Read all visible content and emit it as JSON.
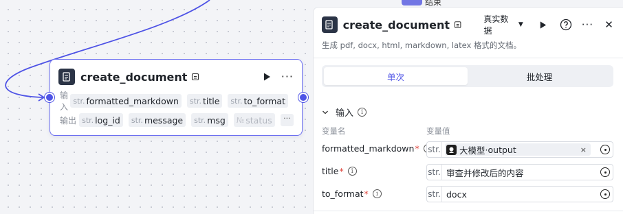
{
  "node": {
    "title": "create_document",
    "input_label": "输入",
    "output_label": "输出",
    "inputs": [
      {
        "type": "str.",
        "name": "formatted_markdown"
      },
      {
        "type": "str.",
        "name": "title"
      },
      {
        "type": "str.",
        "name": "to_format"
      }
    ],
    "outputs": [
      {
        "type": "str.",
        "name": "log_id"
      },
      {
        "type": "str.",
        "name": "message"
      },
      {
        "type": "str.",
        "name": "msg"
      },
      {
        "type": "№",
        "name": "status"
      }
    ],
    "more": "···",
    "icon": "document-plugin-icon"
  },
  "behind_panel": {
    "title_fragment": "结束"
  },
  "panel": {
    "title": "create_document",
    "mode_select": "真实数据",
    "description": "生成 pdf, docx, html, markdown, latex 格式的文档。",
    "tabs": [
      "单次",
      "批处理"
    ],
    "active_tab": 0,
    "section_title": "输入",
    "col_name": "变量名",
    "col_value": "变量值",
    "fields": [
      {
        "label": "formatted_markdown",
        "type": "str.",
        "ref_node": "大模型",
        "ref_sep": " · ",
        "ref_var": "output",
        "clear": "×"
      },
      {
        "label": "title",
        "type": "str.",
        "value": "审查并修改后的内容"
      },
      {
        "label": "to_format",
        "type": "str.",
        "value": "docx"
      }
    ],
    "more": "···",
    "close": "✕"
  },
  "colors": {
    "accent": "#4e53e6",
    "edge": "#4e53e6",
    "required": "#e0433a"
  }
}
